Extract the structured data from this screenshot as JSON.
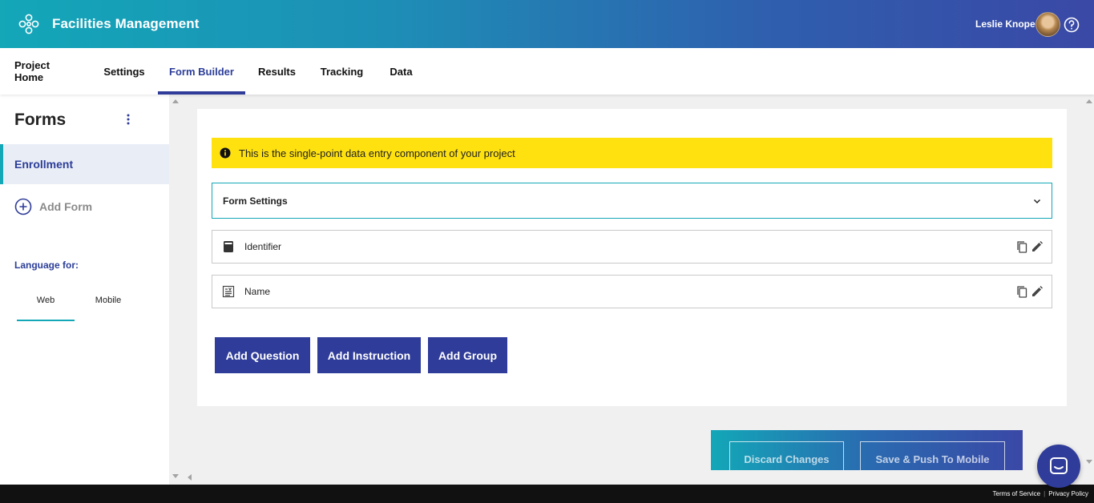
{
  "header": {
    "app_title": "Facilities Management",
    "user_name": "Leslie Knope",
    "logo_icon": "logo-icon",
    "help_icon": "help-icon"
  },
  "tabs": [
    {
      "label": "Project Home",
      "active": false
    },
    {
      "label": "Settings",
      "active": false
    },
    {
      "label": "Form Builder",
      "active": true
    },
    {
      "label": "Results",
      "active": false
    },
    {
      "label": "Tracking",
      "active": false
    },
    {
      "label": "Data",
      "active": false
    }
  ],
  "sidebar": {
    "title": "Forms",
    "forms": [
      {
        "label": "Enrollment",
        "selected": true
      }
    ],
    "add_form_label": "Add Form",
    "language_label": "Language for:",
    "language_tabs": [
      {
        "label": "Web",
        "active": true
      },
      {
        "label": "Mobile",
        "active": false
      }
    ]
  },
  "main": {
    "info_banner": "This is the single-point data entry component of your project",
    "form_settings_label": "Form Settings",
    "items": [
      {
        "label": "Identifier",
        "icon": "identifier-icon"
      },
      {
        "label": "Name",
        "icon": "text-field-icon"
      }
    ],
    "buttons": {
      "add_question": "Add Question",
      "add_instruction": "Add Instruction",
      "add_group": "Add Group"
    }
  },
  "actions": {
    "discard": "Discard Changes",
    "save_push": "Save & Push To Mobile"
  },
  "footer": {
    "terms": "Terms of Service",
    "privacy": "Privacy Policy"
  },
  "colors": {
    "header_start": "#13a7b8",
    "header_end": "#3a48a6",
    "primary": "#2f3c99",
    "banner": "#ffe110",
    "accent": "#13a7b8"
  }
}
